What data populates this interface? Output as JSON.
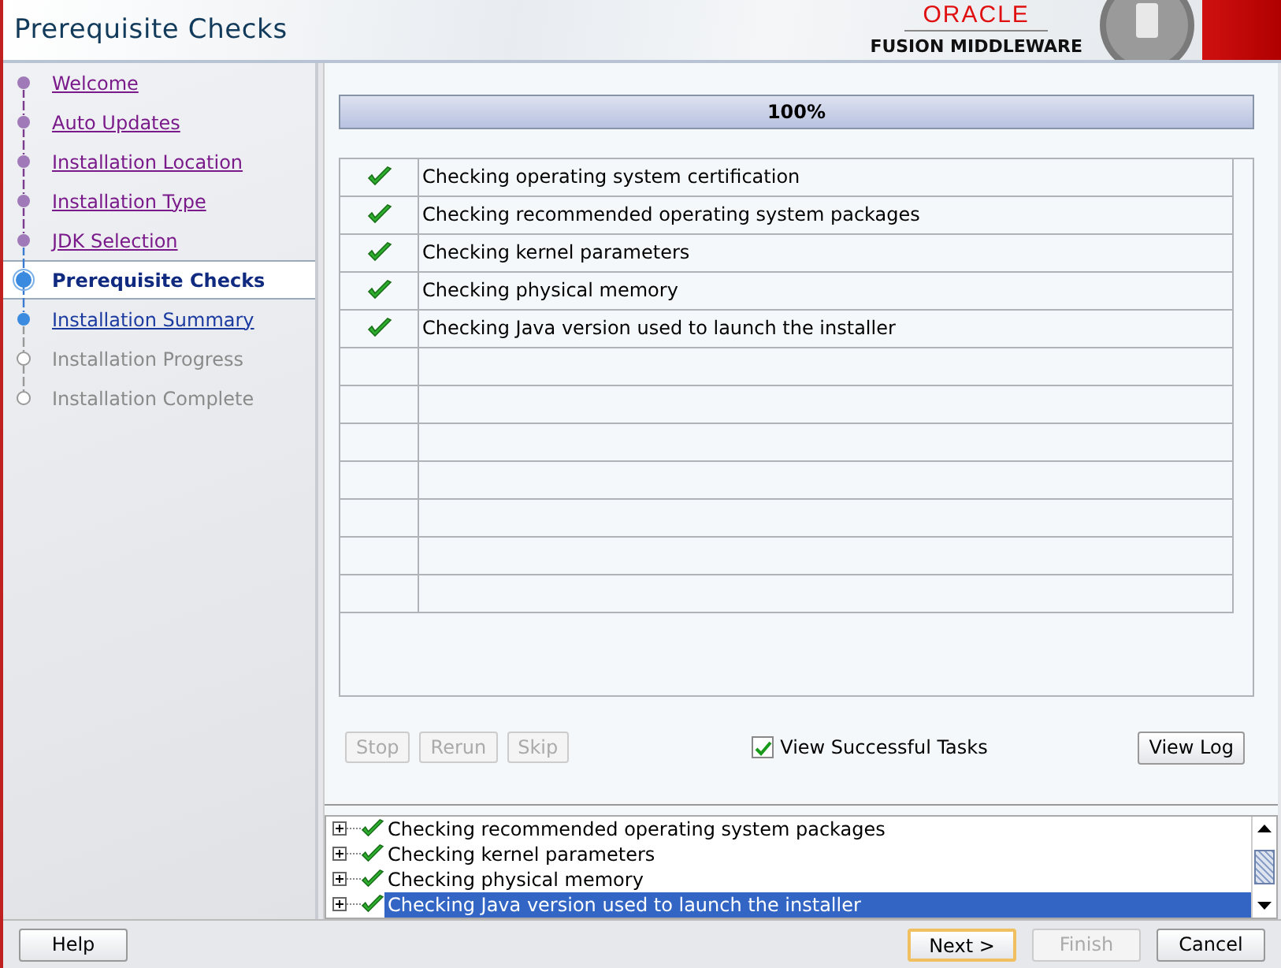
{
  "header": {
    "title": "Prerequisite Checks",
    "brand": "ORACLE",
    "product": "FUSION MIDDLEWARE"
  },
  "steps": [
    {
      "label": "Welcome",
      "done": true,
      "selected": false,
      "enabled": true
    },
    {
      "label": "Auto Updates",
      "done": true,
      "selected": false,
      "enabled": true
    },
    {
      "label": "Installation Location",
      "done": true,
      "selected": false,
      "enabled": true
    },
    {
      "label": "Installation Type",
      "done": true,
      "selected": false,
      "enabled": true
    },
    {
      "label": "JDK Selection",
      "done": true,
      "selected": false,
      "enabled": true
    },
    {
      "label": "Prerequisite Checks",
      "done": false,
      "selected": true,
      "enabled": true
    },
    {
      "label": "Installation Summary",
      "done": false,
      "selected": false,
      "enabled": true
    },
    {
      "label": "Installation Progress",
      "done": false,
      "selected": false,
      "enabled": false
    },
    {
      "label": "Installation Complete",
      "done": false,
      "selected": false,
      "enabled": false
    }
  ],
  "progress": {
    "level": 1,
    "text": "100%"
  },
  "checks": [
    {
      "name": "Checking operating system certification",
      "passed": true
    },
    {
      "name": "Checking recommended operating system packages",
      "passed": true
    },
    {
      "name": "Checking kernel parameters",
      "passed": true
    },
    {
      "name": "Checking physical memory",
      "passed": true
    },
    {
      "name": "Checking Java version used to launch the installer",
      "passed": true
    }
  ],
  "actions": [
    {
      "label": "Stop",
      "disabled": true
    },
    {
      "label": "Rerun",
      "disabled": true
    },
    {
      "label": "Skip",
      "disabled": true
    }
  ],
  "view_successful": {
    "label": "View Successful Tasks",
    "checked": true
  },
  "view_log": "View Log",
  "log": [
    {
      "text": "Checking recommended operating system packages",
      "selected": false
    },
    {
      "text": "Checking kernel parameters",
      "selected": false
    },
    {
      "text": "Checking physical memory",
      "selected": false
    },
    {
      "text": "Checking Java version used to launch the installer",
      "selected": true
    }
  ],
  "footer": {
    "help": "Help",
    "buttons": [
      {
        "label": "Next >",
        "disabled": false,
        "default": true
      },
      {
        "label": "Finish",
        "disabled": true,
        "default": false
      },
      {
        "label": "Cancel",
        "disabled": false,
        "default": false
      }
    ]
  }
}
